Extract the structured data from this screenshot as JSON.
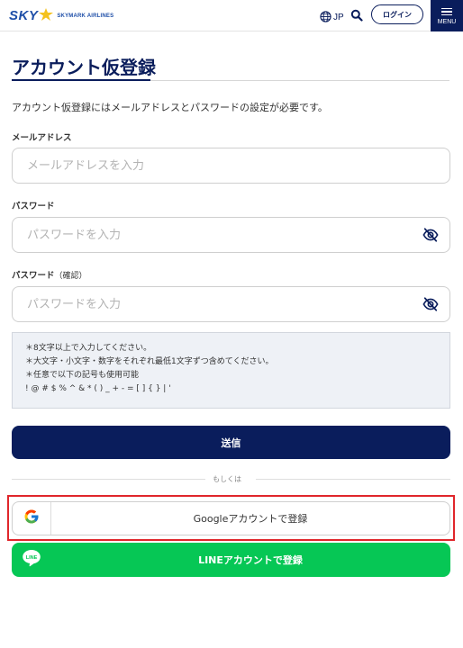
{
  "header": {
    "logo_text": "SKY",
    "logo_subtext": "SKYMARK AIRLINES",
    "lang_label": "JP",
    "login_label": "ログイン",
    "menu_label": "MENU"
  },
  "page": {
    "title": "アカウント仮登録",
    "intro": "アカウント仮登録にはメールアドレスとパスワードの設定が必要です。"
  },
  "form": {
    "email": {
      "label": "メールアドレス",
      "value": "",
      "placeholder": "メールアドレスを入力"
    },
    "password": {
      "label": "パスワード",
      "value": "",
      "placeholder": "パスワードを入力"
    },
    "password_confirm": {
      "label": "パスワード",
      "label_suffix": "（確認）",
      "value": "",
      "placeholder": "パスワードを入力"
    },
    "rules": [
      "＊8文字以上で入力してください。",
      "＊大文字・小文字・数字をそれぞれ最低1文字ずつ含めてください。",
      "＊任意で以下の記号も使用可能",
      "! @ # $ % ^ & * ( ) _ + - = [ ] { } | '"
    ],
    "submit_label": "送信"
  },
  "alt_login": {
    "or_text": "もしくは",
    "google_label": "Googleアカウントで登録",
    "line_label": "LINEアカウントで登録",
    "line_icon_text": "LINE"
  },
  "colors": {
    "navy": "#0a1d5c",
    "line_green": "#06c755",
    "highlight_red": "#e0262b"
  },
  "icons": {
    "lang": "globe-icon",
    "search": "search-icon",
    "menu": "hamburger-icon",
    "password_toggle": "eye-slash-icon",
    "google": "google-g-icon",
    "line": "line-chat-icon"
  }
}
